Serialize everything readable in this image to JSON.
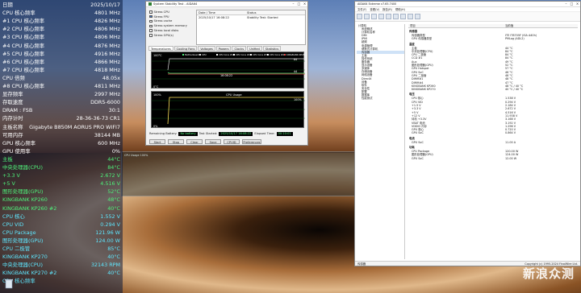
{
  "osd": [
    {
      "label": "日期",
      "value": "2025/10/17",
      "c": "c-white"
    },
    {
      "label": "CPU 核心频率",
      "value": "4801 MHz",
      "c": "c-white"
    },
    {
      "label": "#1 CPU 核心频率",
      "value": "4826 MHz",
      "c": "c-white"
    },
    {
      "label": "#2 CPU 核心频率",
      "value": "4806 MHz",
      "c": "c-white"
    },
    {
      "label": "#3 CPU 核心频率",
      "value": "4806 MHz",
      "c": "c-white"
    },
    {
      "label": "#4 CPU 核心频率",
      "value": "4876 MHz",
      "c": "c-white"
    },
    {
      "label": "#5 CPU 核心频率",
      "value": "4916 MHz",
      "c": "c-white"
    },
    {
      "label": "#6 CPU 核心频率",
      "value": "4866 MHz",
      "c": "c-white"
    },
    {
      "label": "#7 CPU 核心频率",
      "value": "4818 MHz",
      "c": "c-white"
    },
    {
      "label": "CPU 倍频",
      "value": "48.05x",
      "c": "c-white"
    },
    {
      "label": "#8 CPU 核心频率",
      "value": "4811 MHz",
      "c": "c-white"
    },
    {
      "label": "显存频率",
      "value": "2997 MHz",
      "c": "c-white"
    },
    {
      "label": "存取速度",
      "value": "DDR5-6000",
      "c": "c-white"
    },
    {
      "label": "DRAM : FSB",
      "value": "30:1",
      "c": "c-white"
    },
    {
      "label": "内存计时",
      "value": "28-36-36-73 CR1",
      "c": "c-white"
    },
    {
      "label": "主板名称",
      "value": "Gigabyte B850M AORUS PRO WIFI7",
      "c": "c-white"
    },
    {
      "label": "可用内存",
      "value": "38144 MB",
      "c": "c-white"
    },
    {
      "label": "GPU 核心频率",
      "value": "600 MHz",
      "c": "c-white"
    },
    {
      "label": "GPU 使用率",
      "value": "0%",
      "c": "c-white"
    },
    {
      "label": "主板",
      "value": "44°C",
      "c": "c-green"
    },
    {
      "label": "中央处理器(CPU)",
      "value": "84°C",
      "c": "c-green"
    },
    {
      "label": "+3.3 V",
      "value": "2.672 V",
      "c": "c-green"
    },
    {
      "label": "+5 V",
      "value": "4.516 V",
      "c": "c-green"
    },
    {
      "label": "图形处理器(GPU)",
      "value": "52°C",
      "c": "c-green"
    },
    {
      "label": "KINGBANK KP260",
      "value": "48°C",
      "c": "c-green"
    },
    {
      "label": "KINGBANK KP260 #2",
      "value": "40°C",
      "c": "c-green"
    },
    {
      "label": "CPU 核心",
      "value": "1.552 V",
      "c": "c-cyan"
    },
    {
      "label": "CPU VID",
      "value": "0.294 V",
      "c": "c-cyan"
    },
    {
      "label": "CPU Package",
      "value": "121.96 W",
      "c": "c-cyan"
    },
    {
      "label": "图形处理器(GPU)",
      "value": "124.00 W",
      "c": "c-cyan"
    },
    {
      "label": "CPU 二极管",
      "value": "85°C",
      "c": "c-cyan"
    },
    {
      "label": "KINGBANK KP270",
      "value": "40°C",
      "c": "c-cyan"
    },
    {
      "label": "中央处理器(CPU)",
      "value": "32143 RPM",
      "c": "c-cyan"
    },
    {
      "label": "KINGBANK KP270 #2",
      "value": "40°C",
      "c": "c-cyan"
    },
    {
      "label": "CPU 核心频率",
      "value": "",
      "c": "c-cyan"
    }
  ],
  "sst": {
    "title": "System Stability Test - AIDA64",
    "checks": [
      {
        "label": "Stress CPU",
        "on": false
      },
      {
        "label": "Stress FPU",
        "on": true
      },
      {
        "label": "Stress cache",
        "on": false
      },
      {
        "label": "Stress system memory",
        "on": false
      },
      {
        "label": "Stress local disks",
        "on": false
      },
      {
        "label": "Stress GPU(s)",
        "on": false
      }
    ],
    "table_headers": [
      "Date / Time",
      "Status"
    ],
    "table_rows": [
      [
        "2025/10/17 16:08:22",
        "Stability Test: Started"
      ]
    ],
    "tabs": [
      "Temperatures",
      "Cooling Fans",
      "Voltages",
      "Powers",
      "Clocks",
      "Unified",
      "Statistics"
    ],
    "graph1_top": "100°C",
    "graph1_bottom": "0°C",
    "graph1_time": "16:08:22",
    "graph1_series": [
      "Motherboard",
      "CPU",
      "CPU Core #1",
      "CPU Core #2",
      "CPU Core #3",
      "CPU Core #4",
      "KINGBANK KP260"
    ],
    "graph1_values": [
      "84",
      "44"
    ],
    "graph2_title": "CPU Usage",
    "graph2_top": "100%",
    "graph2_bottom": "0%",
    "graph2_right": "100%",
    "remaining_label": "Remaining Battery:",
    "remaining_value": "No battery",
    "started_label": "Test Started:",
    "started_value": "2025/10/17 16:08:22",
    "elapsed_label": "Elapsed Time:",
    "elapsed_value": "00:10:01",
    "buttons": [
      "Start",
      "Stop",
      "Clear",
      "Save",
      "CPUID",
      "Preferences"
    ]
  },
  "sens": {
    "title": "AIDA64 Extreme v7.65.7400",
    "menu": [
      "文件(F)",
      "查看(V)",
      "报告(R)",
      "帮助(H)"
    ],
    "tree": [
      "计算机",
      "系统概述",
      "计算机名称",
      "DMI",
      "IPMI",
      "超频",
      "电源管理",
      "便携式计算机",
      "传感器",
      "主板",
      "操作系统",
      "服务器",
      "显示设备",
      "多媒体",
      "存储设备",
      "网络设备",
      "DirectX",
      "设备",
      "软件",
      "安全性",
      "配置",
      "数据库",
      "性能测试"
    ],
    "col_headers": [
      "项目",
      "当前值"
    ],
    "sections": [
      {
        "name": "传感器",
        "rows": [
          [
            "传感器类型",
            "ITE IT8705F (ISA A40h)"
          ],
          [
            "GPU 传感器类型",
            "PMLog (ADL2)"
          ]
        ]
      },
      {
        "name": "温度",
        "rows": [
          [
            "主板",
            "44 °C"
          ],
          [
            "中央处理器(CPU)",
            "84 °C"
          ],
          [
            "CPU 二极管",
            "84 °C"
          ],
          [
            "CCD #1",
            "84 °C"
          ],
          [
            "Aux",
            "49 °C"
          ],
          [
            "图形处理器(GPU)",
            "52 °C"
          ],
          [
            "GPU Hotspot",
            "57 °C"
          ],
          [
            "GPU SoC",
            "46 °C"
          ],
          [
            "GPU 二极管",
            "48 °C"
          ],
          [
            "DIMM#1",
            "48 °C"
          ],
          [
            "DIMM#4",
            "47 °C"
          ],
          [
            "KINGBANK KP260",
            "48 °C / 40 °C"
          ],
          [
            "KINGBANK KP270",
            "40 °C / 40 °C"
          ]
        ]
      },
      {
        "name": "电压",
        "rows": [
          [
            "CPU 核心",
            "1.538 V"
          ],
          [
            "CPU VID",
            "0.294 V"
          ],
          [
            "+1.5 V",
            "2.184 V"
          ],
          [
            "+3.3 V",
            "2.672 V"
          ],
          [
            "+5 V",
            "4.516 V"
          ],
          [
            "+12 V",
            "11.938 V"
          ],
          [
            "待机 +3.3V",
            "3.168 V"
          ],
          [
            "VBAT 电池",
            "3.192 V"
          ],
          [
            "VDDIO 内存",
            "1.296 V"
          ],
          [
            "GPU 核心",
            "0.720 V"
          ],
          [
            "GPU SoC",
            "0.864 V"
          ]
        ]
      },
      {
        "name": "电流",
        "rows": [
          [
            "GPU SoC",
            "11.00 A"
          ]
        ]
      },
      {
        "name": "功耗",
        "rows": [
          [
            "CPU Package",
            "120.00 W"
          ],
          [
            "图形处理器(GPU)",
            "124.00 W"
          ],
          [
            "GPU SoC",
            "12.00 W"
          ]
        ]
      }
    ],
    "status_left": "传感器",
    "status_right": "Copyright (c) 1995-2024 FinalWire Ltd."
  },
  "ghost_title": "CPU Usage 100%",
  "watermark": "新浪众测"
}
